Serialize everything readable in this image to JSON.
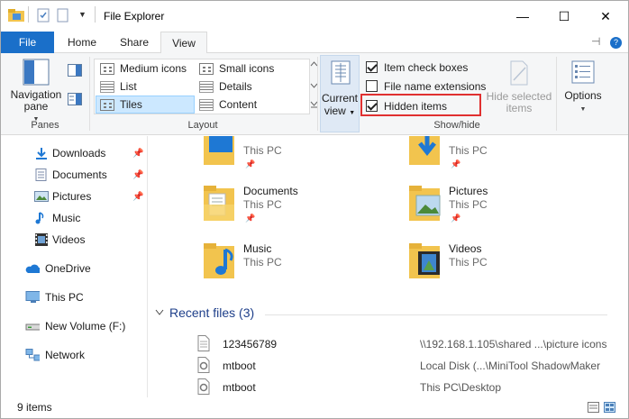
{
  "window": {
    "title": "File Explorer"
  },
  "titlebar": {
    "minimize_glyph": "—",
    "maximize_glyph": "☐",
    "close_glyph": "✕"
  },
  "tabs": {
    "file": "File",
    "home": "Home",
    "share": "Share",
    "view": "View",
    "active": "View"
  },
  "ribbon": {
    "panes": {
      "navigation_pane": [
        "Navigation",
        "pane"
      ],
      "label": "Panes"
    },
    "layout": {
      "items": [
        "Medium icons",
        "Small icons",
        "List",
        "Details",
        "Tiles",
        "Content"
      ],
      "selected": "Tiles",
      "label": "Layout"
    },
    "current_view": {
      "line1": "Current",
      "line2": "view"
    },
    "show_hide": {
      "item_check_boxes": "Item check boxes",
      "item_check_boxes_checked": true,
      "file_name_extensions": "File name extensions",
      "file_name_extensions_checked": false,
      "hidden_items": "Hidden items",
      "hidden_items_checked": true,
      "hide_selected_items": [
        "Hide selected",
        "items"
      ],
      "label": "Show/hide"
    },
    "options": {
      "label": "Options"
    }
  },
  "nav": {
    "items": [
      {
        "label": "Downloads",
        "icon": "downloads-icon",
        "pinned": true
      },
      {
        "label": "Documents",
        "icon": "documents-icon",
        "pinned": true
      },
      {
        "label": "Pictures",
        "icon": "pictures-icon",
        "pinned": true
      },
      {
        "label": "Music",
        "icon": "music-icon",
        "pinned": false
      },
      {
        "label": "Videos",
        "icon": "videos-icon",
        "pinned": false
      },
      {
        "label": "OneDrive",
        "icon": "onedrive-icon",
        "pinned": false
      },
      {
        "label": "This PC",
        "icon": "this-pc-icon",
        "pinned": false
      },
      {
        "label": "New Volume (F:)",
        "icon": "drive-icon",
        "pinned": false
      },
      {
        "label": "Network",
        "icon": "network-icon",
        "pinned": false
      }
    ]
  },
  "content": {
    "tiles": [
      {
        "name": "",
        "location": "This PC",
        "icon": "desktop-folder-icon"
      },
      {
        "name": "",
        "location": "This PC",
        "icon": "downloads-folder-icon"
      },
      {
        "name": "Documents",
        "location": "This PC",
        "icon": "documents-folder-icon"
      },
      {
        "name": "Pictures",
        "location": "This PC",
        "icon": "pictures-folder-icon"
      },
      {
        "name": "Music",
        "location": "This PC",
        "icon": "music-folder-icon"
      },
      {
        "name": "Videos",
        "location": "This PC",
        "icon": "videos-folder-icon"
      }
    ],
    "recent_header": "Recent files (3)",
    "recent_files": [
      {
        "name": "123456789",
        "location": "\\\\192.168.1.105\\shared ...\\picture icons",
        "icon": "text-file-icon"
      },
      {
        "name": "mtboot",
        "location": "Local Disk (...\\MiniTool ShadowMaker",
        "icon": "settings-file-icon"
      },
      {
        "name": "mtboot",
        "location": "This PC\\Desktop",
        "icon": "settings-file-icon"
      }
    ]
  },
  "status": {
    "item_count": "9 items"
  },
  "colors": {
    "file_tab": "#1a6fc9",
    "accent_blue": "#1e78d4",
    "folder_yellow": "#f2c44e",
    "highlight_red": "#e03030",
    "selection": "#cce8ff"
  }
}
